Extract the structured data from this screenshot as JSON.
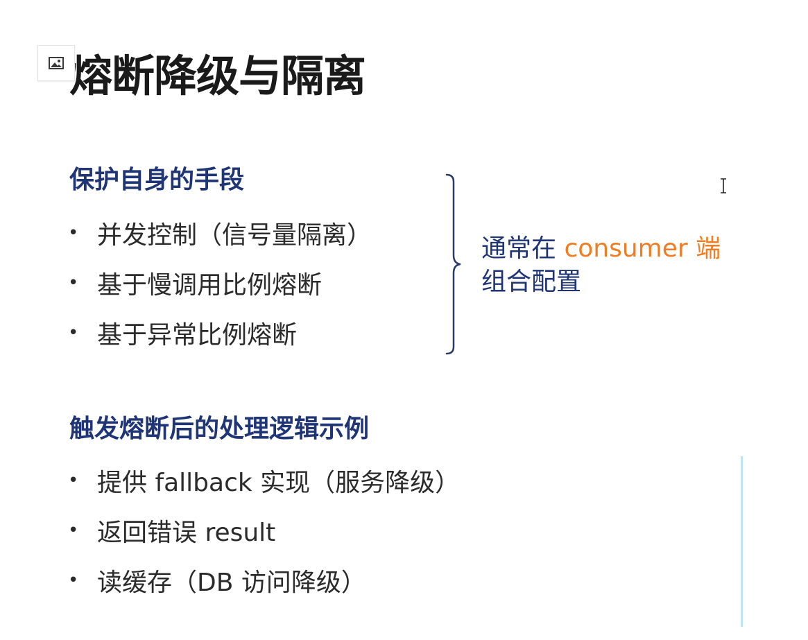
{
  "title": "熔断降级与隔离",
  "section1": {
    "heading": "保护自身的手段",
    "items": [
      "并发控制（信号量隔离）",
      "基于慢调用比例熔断",
      "基于异常比例熔断"
    ]
  },
  "note": {
    "prefix": "通常在 ",
    "accent": "consumer 端",
    "line2": "组合配置"
  },
  "section2": {
    "heading": "触发熔断后的处理逻辑示例",
    "items": [
      "提供 fallback 实现（服务降级）",
      "返回错误 result",
      "读缓存（DB 访问降级）"
    ]
  },
  "bullet_symbol": "•",
  "icons": {
    "placeholder": "image-icon",
    "cursor": "text-cursor-icon"
  },
  "colors": {
    "title": "#1a1a1a",
    "heading": "#1f3575",
    "body": "#2b2b2b",
    "accent": "#f07d22"
  }
}
